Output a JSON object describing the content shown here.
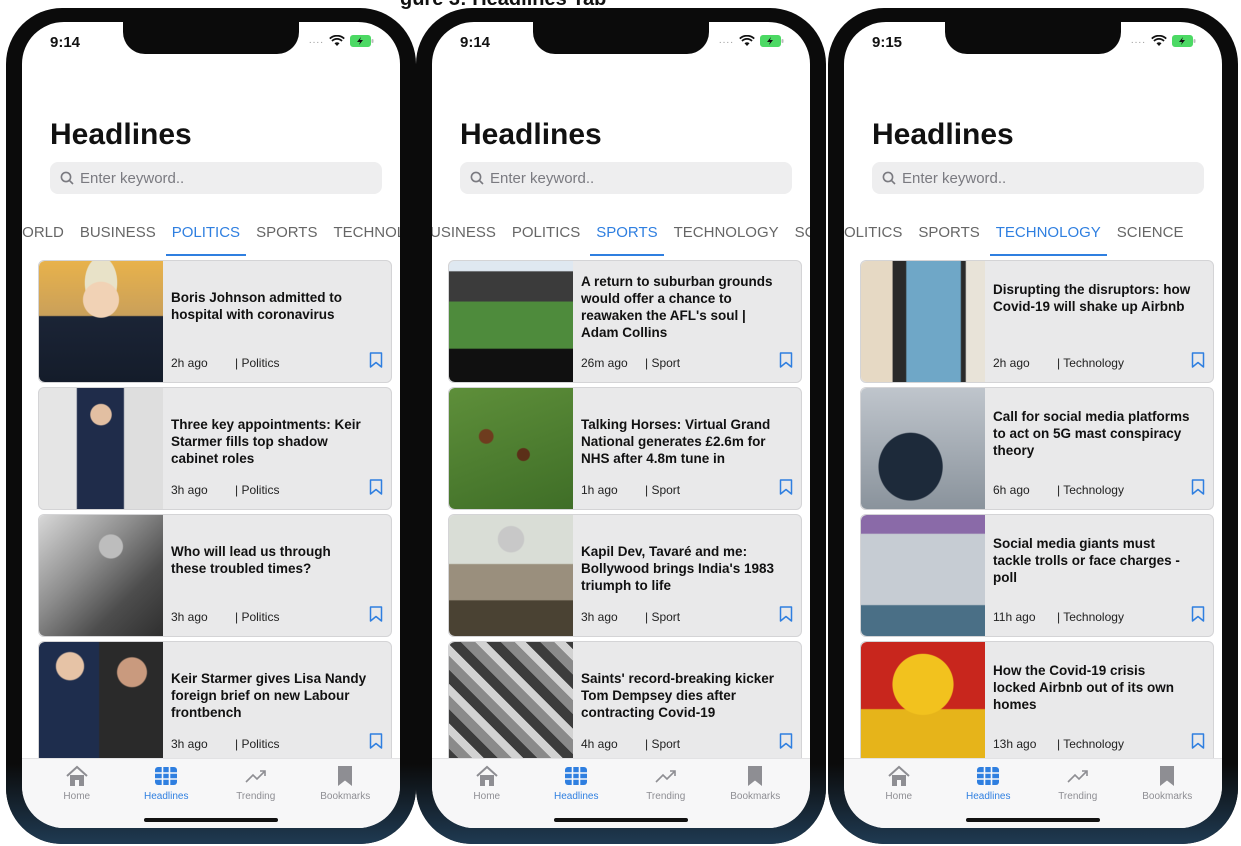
{
  "header_caption": "gure 3: Headlines Tab",
  "status_icons": {
    "signal": "signal-dots",
    "wifi": "wifi-icon",
    "battery": "battery-charging-icon"
  },
  "colors": {
    "accent": "#2f7fe0",
    "card_bg": "#e9e9ea",
    "text": "#111111",
    "muted": "#8e8e93"
  },
  "phones": [
    {
      "time": "9:14",
      "title": "Headlines",
      "search_placeholder": "Enter keyword..",
      "active_tab": "POLITICS",
      "tabs": [
        "WORLD",
        "BUSINESS",
        "POLITICS",
        "SPORTS",
        "TECHNOLOGY"
      ],
      "cards": [
        {
          "title": "Boris Johnson admitted to hospital with coronavirus",
          "time": "2h ago",
          "section": "| Politics"
        },
        {
          "title": "Three key appointments: Keir Starmer fills top shadow cabinet roles",
          "time": "3h ago",
          "section": "| Politics"
        },
        {
          "title": "Who will lead us through these troubled times?",
          "time": "3h ago",
          "section": "| Politics"
        },
        {
          "title": "Keir Starmer gives Lisa Nandy foreign brief on new Labour frontbench",
          "time": "3h ago",
          "section": "| Politics"
        }
      ]
    },
    {
      "time": "9:14",
      "title": "Headlines",
      "search_placeholder": "Enter keyword..",
      "active_tab": "SPORTS",
      "tabs": [
        "BUSINESS",
        "POLITICS",
        "SPORTS",
        "TECHNOLOGY",
        "SCIENCE"
      ],
      "cards": [
        {
          "title": "A return to suburban grounds would offer a chance to reawaken the AFL's soul | Adam Collins",
          "time": "26m ago",
          "section": "| Sport"
        },
        {
          "title": "Talking Horses: Virtual Grand National generates £2.6m for NHS after 4.8m tune in",
          "time": "1h ago",
          "section": "| Sport"
        },
        {
          "title": "Kapil Dev, Tavaré and me: Bollywood brings India's 1983 triumph to life",
          "time": "3h ago",
          "section": "| Sport"
        },
        {
          "title": "Saints' record-breaking kicker Tom Dempsey dies after contracting Covid-19",
          "time": "4h ago",
          "section": "| Sport"
        }
      ]
    },
    {
      "time": "9:15",
      "title": "Headlines",
      "search_placeholder": "Enter keyword..",
      "active_tab": "TECHNOLOGY",
      "tabs": [
        "POLITICS",
        "SPORTS",
        "TECHNOLOGY",
        "SCIENCE"
      ],
      "cards": [
        {
          "title": "Disrupting the disruptors: how Covid-19 will shake up Airbnb",
          "time": "2h ago",
          "section": "| Technology"
        },
        {
          "title": "Call for social media platforms  to act on 5G mast conspiracy theory",
          "time": "6h ago",
          "section": "| Technology"
        },
        {
          "title": "Social media giants must tackle trolls or face charges - poll",
          "time": "11h ago",
          "section": "| Technology"
        },
        {
          "title": "How the Covid-19 crisis locked Airbnb out of its own homes",
          "time": "13h ago",
          "section": "| Technology"
        }
      ]
    }
  ],
  "tabbar": [
    {
      "label": "Home",
      "icon": "home-icon"
    },
    {
      "label": "Headlines",
      "icon": "grid-icon"
    },
    {
      "label": "Trending",
      "icon": "trending-icon"
    },
    {
      "label": "Bookmarks",
      "icon": "bookmark-icon"
    }
  ],
  "active_tabbar": "Headlines"
}
